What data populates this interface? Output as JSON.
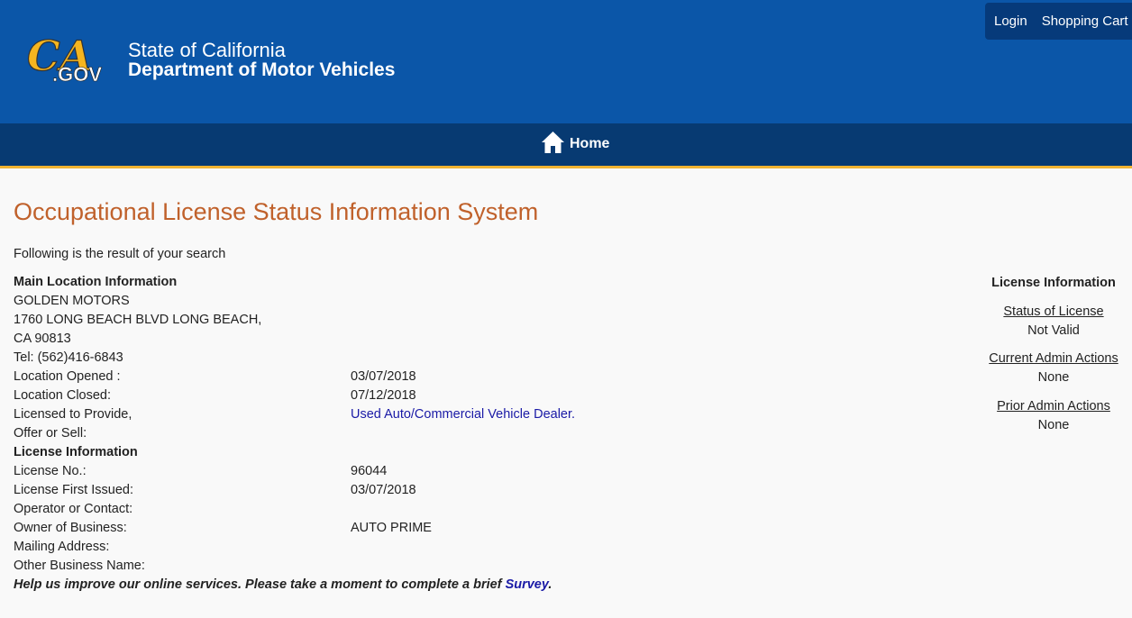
{
  "header": {
    "logo_text": "CA.GOV",
    "state_name": "State of California",
    "department": "Department of Motor Vehicles",
    "login_label": "Login",
    "cart_label": "Shopping Cart",
    "brand_color": "#0b56a8"
  },
  "nav": {
    "home_label": "Home",
    "home_icon": "home-icon"
  },
  "page": {
    "title": "Occupational License Status Information System",
    "intro": "Following is the result of your search"
  },
  "main_location": {
    "heading": "Main Location Information",
    "business_name": "GOLDEN MOTORS",
    "address_line1": "1760 LONG BEACH BLVD  LONG BEACH,",
    "address_line2": "CA  90813",
    "phone": "Tel: (562)416-6843",
    "opened_label": "Location Opened :",
    "opened_value": "03/07/2018",
    "closed_label": "Location Closed:",
    "closed_value": "07/12/2018",
    "licensed_label_1": "Licensed to Provide,",
    "licensed_label_2": "Offer or Sell:",
    "licensed_value": "Used Auto/Commercial Vehicle Dealer."
  },
  "license_info": {
    "heading": "License Information",
    "number_label": "License No.:",
    "number_value": "96044",
    "first_issued_label": "License First Issued:",
    "first_issued_value": "03/07/2018",
    "operator_label": "Operator or Contact:",
    "owner_label": "Owner of Business:",
    "owner_value": "AUTO PRIME",
    "mailing_label": "Mailing Address:",
    "other_name_label": "Other Business Name:"
  },
  "survey": {
    "text": "Help us improve our online services. Please take a moment to complete a brief ",
    "link": "Survey",
    "end": "."
  },
  "sidebar": {
    "title": "License Information",
    "status_link": "Status of License",
    "status_value": "Not Valid",
    "current_link": "Current Admin Actions",
    "current_value": "None",
    "prior_link": "Prior Admin Actions",
    "prior_value": "None"
  }
}
